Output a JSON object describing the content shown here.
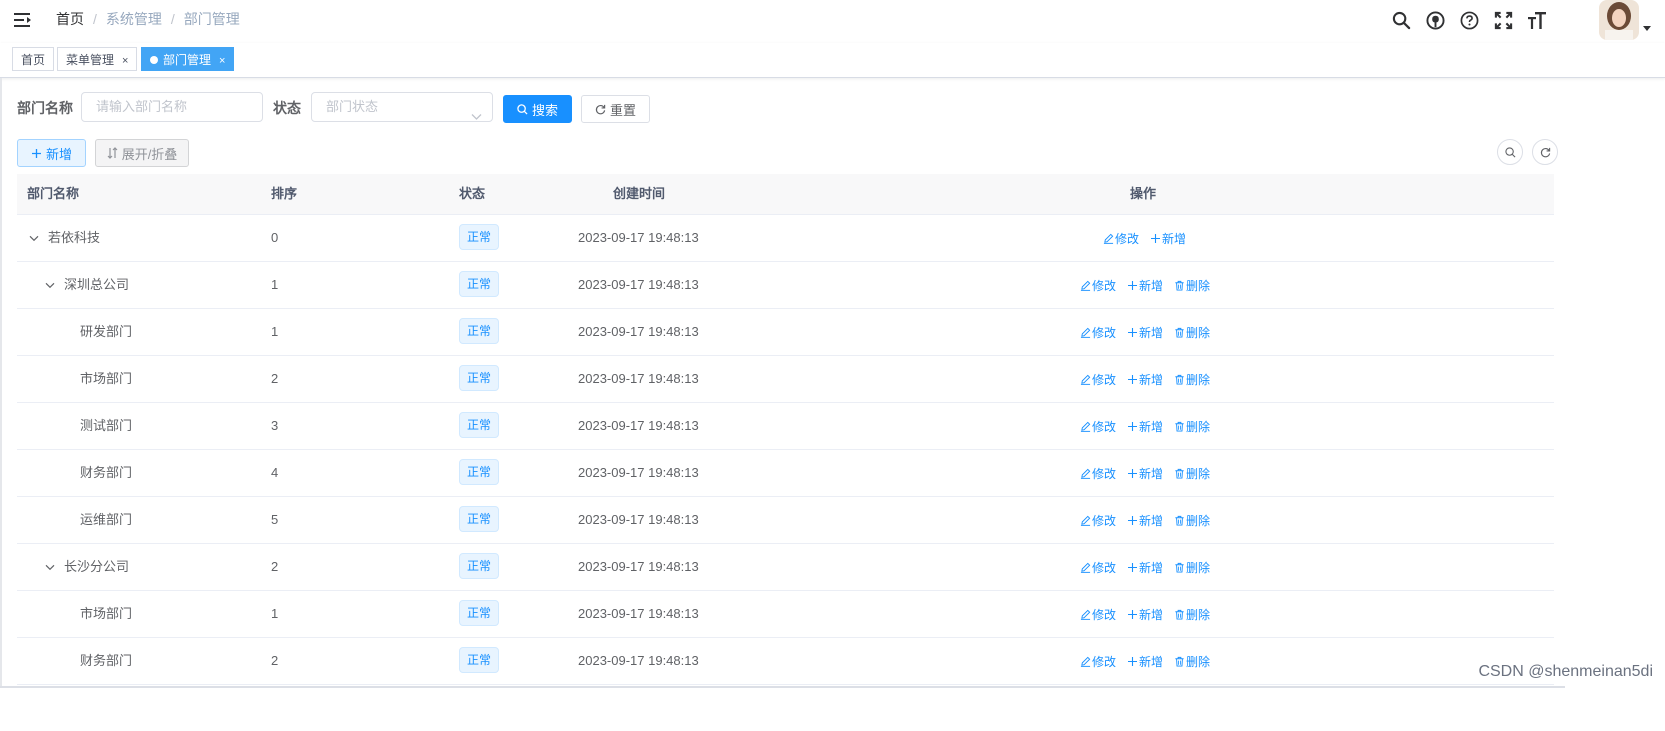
{
  "breadcrumb": {
    "home": "首页",
    "sep": "/",
    "level1": "系统管理",
    "level2": "部门管理"
  },
  "navbar_icons": [
    "search-icon",
    "github-icon",
    "question-icon",
    "fullscreen-icon",
    "font-size-icon"
  ],
  "tags": {
    "home": "首页",
    "menu": "菜单管理",
    "dept": "部门管理",
    "close": "×"
  },
  "search": {
    "dept_label": "部门名称",
    "dept_placeholder": "请输入部门名称",
    "status_label": "状态",
    "status_placeholder": "部门状态",
    "search_btn": "搜索",
    "reset_btn": "重置"
  },
  "toolbar": {
    "add": "新增",
    "expand": "展开/折叠"
  },
  "table": {
    "headers": {
      "name": "部门名称",
      "sort": "排序",
      "status": "状态",
      "created": "创建时间",
      "ops": "操作"
    },
    "op_edit": "修改",
    "op_add": "新增",
    "op_delete": "删除",
    "rows": [
      {
        "name": "若依科技",
        "sort": "0",
        "status": "正常",
        "created": "2023-09-17 19:48:13",
        "level": 0,
        "expandable": true,
        "deletable": false
      },
      {
        "name": "深圳总公司",
        "sort": "1",
        "status": "正常",
        "created": "2023-09-17 19:48:13",
        "level": 1,
        "expandable": true,
        "deletable": true
      },
      {
        "name": "研发部门",
        "sort": "1",
        "status": "正常",
        "created": "2023-09-17 19:48:13",
        "level": 2,
        "expandable": false,
        "deletable": true
      },
      {
        "name": "市场部门",
        "sort": "2",
        "status": "正常",
        "created": "2023-09-17 19:48:13",
        "level": 2,
        "expandable": false,
        "deletable": true
      },
      {
        "name": "测试部门",
        "sort": "3",
        "status": "正常",
        "created": "2023-09-17 19:48:13",
        "level": 2,
        "expandable": false,
        "deletable": true
      },
      {
        "name": "财务部门",
        "sort": "4",
        "status": "正常",
        "created": "2023-09-17 19:48:13",
        "level": 2,
        "expandable": false,
        "deletable": true
      },
      {
        "name": "运维部门",
        "sort": "5",
        "status": "正常",
        "created": "2023-09-17 19:48:13",
        "level": 2,
        "expandable": false,
        "deletable": true
      },
      {
        "name": "长沙分公司",
        "sort": "2",
        "status": "正常",
        "created": "2023-09-17 19:48:13",
        "level": 1,
        "expandable": true,
        "deletable": true
      },
      {
        "name": "市场部门",
        "sort": "1",
        "status": "正常",
        "created": "2023-09-17 19:48:13",
        "level": 2,
        "expandable": false,
        "deletable": true
      },
      {
        "name": "财务部门",
        "sort": "2",
        "status": "正常",
        "created": "2023-09-17 19:48:13",
        "level": 2,
        "expandable": false,
        "deletable": true
      }
    ]
  },
  "watermark": "CSDN @shenmeinan5di",
  "colors": {
    "primary": "#1890ff",
    "tag_active": "#42a5f5",
    "header_bg": "#f8f8f9"
  }
}
